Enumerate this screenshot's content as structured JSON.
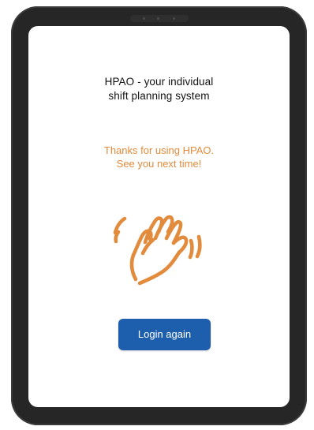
{
  "screen": {
    "title_line_1": "HPAO - your individual",
    "title_line_2": "shift planning system",
    "thanks_line_1": "Thanks for using HPAO.",
    "thanks_line_2": "See you next time!",
    "wave_icon": "waving-hand-icon",
    "login_button_label": "Login again"
  },
  "colors": {
    "accent": "#e28b3c",
    "button": "#1e5fad",
    "device_frame": "#262626",
    "text": "#111111"
  }
}
